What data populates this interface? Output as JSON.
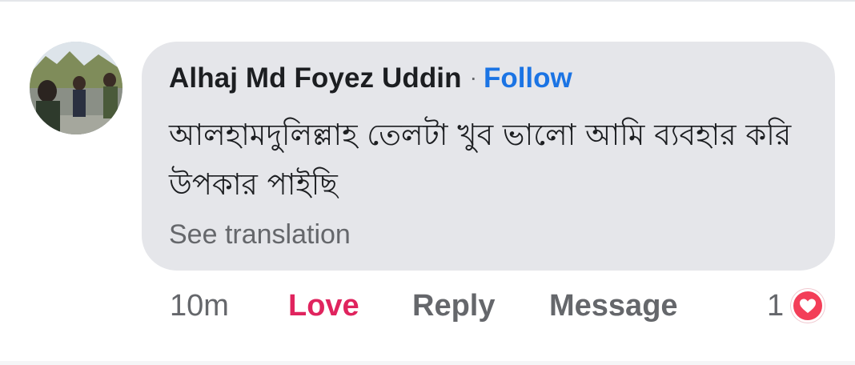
{
  "comment": {
    "author_name": "Alhaj Md Foyez Uddin",
    "separator": "·",
    "follow_label": "Follow",
    "text": "আলহামদুলিল্লাহ তেলটা খুব ভালো আমি ব্যবহার করি উপকার পাইছি",
    "see_translation_label": "See translation"
  },
  "actions": {
    "time": "10m",
    "love_label": "Love",
    "reply_label": "Reply",
    "message_label": "Message",
    "reaction_count": "1",
    "reaction_icon": "heart-icon"
  },
  "colors": {
    "bubble_background": "#e5e6ea",
    "follow_link": "#1b74e4",
    "love_active": "#e0245e",
    "reaction_heart": "#f33e58",
    "secondary_text": "#65676b",
    "primary_text": "#1c1e21"
  }
}
